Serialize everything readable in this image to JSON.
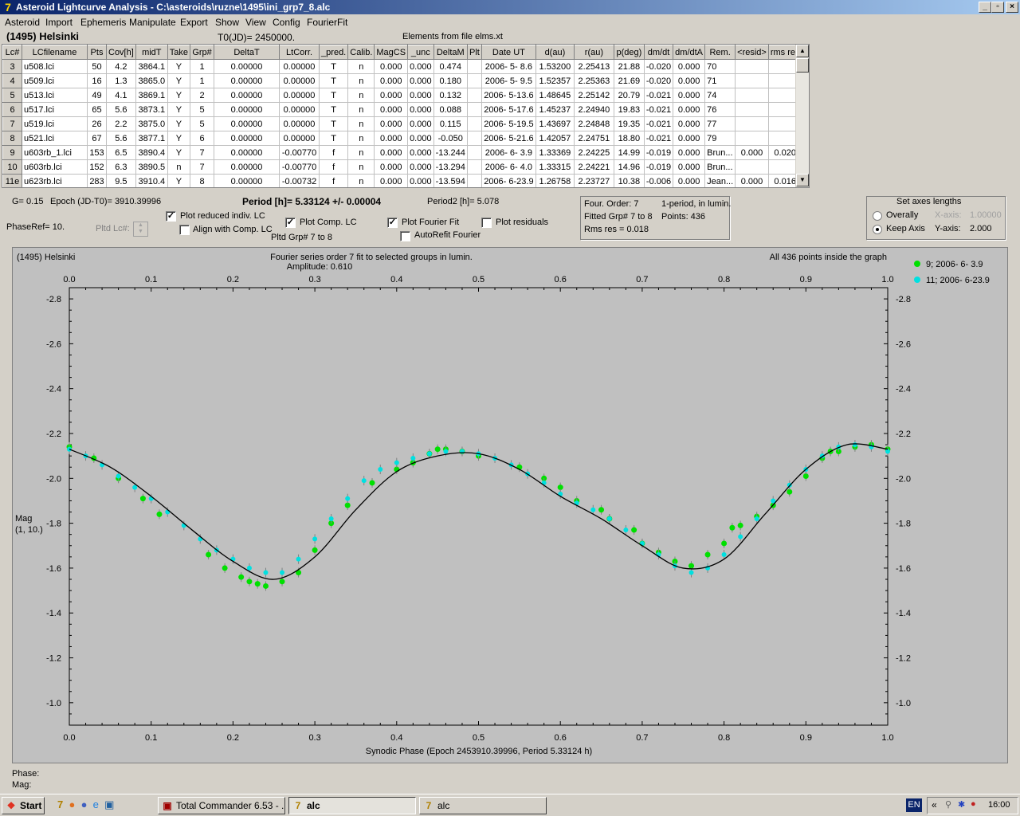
{
  "window": {
    "title": "Asteroid Lightcurve Analysis - C:\\asteroids\\ruzne\\1495\\ini_grp7_8.alc",
    "min_label": "_",
    "max_label": "▫",
    "close_label": "×"
  },
  "menu": [
    "Asteroid",
    "Import",
    "Ephemeris",
    "Manipulate",
    "Export",
    "Show",
    "View",
    "Config",
    "FourierFit"
  ],
  "header": {
    "asteroid": "(1495) Helsinki",
    "t0": "T0(JD)= 2450000.",
    "elements": "Elements from file elms.xt"
  },
  "table": {
    "columns": [
      "Lc#",
      "LCfilename",
      "Pts",
      "Cov[h]",
      "midT",
      "Take",
      "Grp#",
      "DeltaT",
      "LtCorr.",
      "_pred.",
      "Calib.",
      "MagCS",
      "_unc",
      "DeltaM",
      "Plt",
      "Date UT",
      "d(au)",
      "r(au)",
      "p(deg)",
      "dm/dt",
      "dm/dtA",
      "Rem.",
      "<resid>",
      "rms res"
    ],
    "rows": [
      [
        "3",
        "u508.lci",
        "50",
        "4.2",
        "3864.1",
        "Y",
        "1",
        "0.00000",
        "0.00000",
        "T",
        "n",
        "0.000",
        "0.000",
        "0.474",
        "",
        "2006- 5- 8.6",
        "1.53200",
        "2.25413",
        "21.88",
        "-0.020",
        "0.000",
        "70",
        "",
        ""
      ],
      [
        "4",
        "u509.lci",
        "16",
        "1.3",
        "3865.0",
        "Y",
        "1",
        "0.00000",
        "0.00000",
        "T",
        "n",
        "0.000",
        "0.000",
        "0.180",
        "",
        "2006- 5- 9.5",
        "1.52357",
        "2.25363",
        "21.69",
        "-0.020",
        "0.000",
        "71",
        "",
        ""
      ],
      [
        "5",
        "u513.lci",
        "49",
        "4.1",
        "3869.1",
        "Y",
        "2",
        "0.00000",
        "0.00000",
        "T",
        "n",
        "0.000",
        "0.000",
        "0.132",
        "",
        "2006- 5-13.6",
        "1.48645",
        "2.25142",
        "20.79",
        "-0.021",
        "0.000",
        "74",
        "",
        ""
      ],
      [
        "6",
        "u517.lci",
        "65",
        "5.6",
        "3873.1",
        "Y",
        "5",
        "0.00000",
        "0.00000",
        "T",
        "n",
        "0.000",
        "0.000",
        "0.088",
        "",
        "2006- 5-17.6",
        "1.45237",
        "2.24940",
        "19.83",
        "-0.021",
        "0.000",
        "76",
        "",
        ""
      ],
      [
        "7",
        "u519.lci",
        "26",
        "2.2",
        "3875.0",
        "Y",
        "5",
        "0.00000",
        "0.00000",
        "T",
        "n",
        "0.000",
        "0.000",
        "0.115",
        "",
        "2006- 5-19.5",
        "1.43697",
        "2.24848",
        "19.35",
        "-0.021",
        "0.000",
        "77",
        "",
        ""
      ],
      [
        "8",
        "u521.lci",
        "67",
        "5.6",
        "3877.1",
        "Y",
        "6",
        "0.00000",
        "0.00000",
        "T",
        "n",
        "0.000",
        "0.000",
        "-0.050",
        "",
        "2006- 5-21.6",
        "1.42057",
        "2.24751",
        "18.80",
        "-0.021",
        "0.000",
        "79",
        "",
        ""
      ],
      [
        "9",
        "u603rb_1.lci",
        "153",
        "6.5",
        "3890.4",
        "Y",
        "7",
        "0.00000",
        "-0.00770",
        "f",
        "n",
        "0.000",
        "0.000",
        "-13.244",
        "",
        "2006- 6- 3.9",
        "1.33369",
        "2.24225",
        "14.99",
        "-0.019",
        "0.000",
        "Brun...",
        "0.000",
        "0.020"
      ],
      [
        "10",
        "u603rb.lci",
        "152",
        "6.3",
        "3890.5",
        "n",
        "7",
        "0.00000",
        "-0.00770",
        "f",
        "n",
        "0.000",
        "0.000",
        "-13.294",
        "",
        "2006- 6- 4.0",
        "1.33315",
        "2.24221",
        "14.96",
        "-0.019",
        "0.000",
        "Brun...",
        "",
        ""
      ],
      [
        "11e",
        "u623rb.lci",
        "283",
        "9.5",
        "3910.4",
        "Y",
        "8",
        "0.00000",
        "-0.00732",
        "f",
        "n",
        "0.000",
        "0.000",
        "-13.594",
        "",
        "2006- 6-23.9",
        "1.26758",
        "2.23727",
        "10.38",
        "-0.006",
        "0.000",
        "Jean...",
        "0.000",
        "0.016"
      ]
    ]
  },
  "params": {
    "g": "G= 0.15",
    "epoch": "Epoch (JD-T0)= 3910.39996",
    "period": "Period [h]= 5.33124 +/- 0.00004",
    "period2": "Period2 [h]= 5.078",
    "phaseref": "PhaseRef= 10.",
    "pltd_lc": "Pltd Lc#:",
    "plot_reduced": "Plot reduced indiv. LC",
    "align_comp": "Align with Comp. LC",
    "plot_comp": "Plot Comp. LC",
    "pltd_grp": "Pltd Grp#  7  to  8",
    "plot_fourier": "Plot Fourier Fit",
    "autorefit": "AutoRefit Fourier",
    "plot_residuals": "Plot residuals"
  },
  "fourier_box": {
    "order": "Four. Order:  7",
    "mode": "1-period, in lumin.",
    "fitted": "Fitted Grp# 7 to 8",
    "points": "Points: 436",
    "rms": "Rms res     = 0.018"
  },
  "axes_box": {
    "title": "Set axes lengths",
    "overally": "Overally",
    "keep_axis": "Keep Axis",
    "xaxis_label": "X-axis:",
    "xaxis_value": "1.00000",
    "yaxis_label": "Y-axis:",
    "yaxis_value": "2.000"
  },
  "plot": {
    "name": "(1495) Helsinki",
    "subtitle": "Fourier series order 7 fit to selected groups in lumin.",
    "amplitude": "Amplitude: 0.610",
    "inside": "All 436 points inside the graph",
    "ylabel1": "Mag",
    "ylabel2": "(1, 10.)"
  },
  "chart_data": {
    "type": "scatter",
    "title": "Fourier series order 7 fit to selected groups in lumin.",
    "xlabel": "Synodic Phase (Epoch 2453910.39996, Period 5.33124 h)",
    "ylabel": "Mag",
    "xlim": [
      0.0,
      1.0
    ],
    "ylim": [
      -0.9,
      -2.85
    ],
    "y_inverted": true,
    "grid": false,
    "legend_position": "top-right",
    "x_ticks": [
      "0.0",
      "0.1",
      "0.2",
      "0.3",
      "0.4",
      "0.5",
      "0.6",
      "0.7",
      "0.8",
      "0.9",
      "1.0"
    ],
    "y_ticks": [
      "-2.8",
      "-2.6",
      "-2.4",
      "-2.2",
      "-2.0",
      "-1.8",
      "-1.6",
      "-1.4",
      "-1.2",
      "-1.0"
    ],
    "fit_curve": {
      "x": [
        0.0,
        0.05,
        0.1,
        0.15,
        0.2,
        0.25,
        0.3,
        0.35,
        0.4,
        0.45,
        0.5,
        0.55,
        0.6,
        0.65,
        0.7,
        0.75,
        0.8,
        0.85,
        0.9,
        0.95,
        1.0
      ],
      "y": [
        -2.13,
        -2.05,
        -1.92,
        -1.77,
        -1.63,
        -1.55,
        -1.65,
        -1.86,
        -2.03,
        -2.1,
        -2.11,
        -2.04,
        -1.92,
        -1.82,
        -1.7,
        -1.6,
        -1.64,
        -1.84,
        -2.04,
        -2.15,
        -2.13
      ]
    },
    "series": [
      {
        "name": "9; 2006- 6- 3.9",
        "color": "#00e000",
        "x": [
          0.0,
          0.03,
          0.06,
          0.09,
          0.11,
          0.17,
          0.19,
          0.21,
          0.22,
          0.23,
          0.24,
          0.26,
          0.28,
          0.3,
          0.32,
          0.34,
          0.37,
          0.4,
          0.42,
          0.44,
          0.45,
          0.46,
          0.48,
          0.5,
          0.55,
          0.58,
          0.6,
          0.62,
          0.65,
          0.66,
          0.69,
          0.7,
          0.72,
          0.74,
          0.76,
          0.78,
          0.8,
          0.81,
          0.82,
          0.84,
          0.86,
          0.88,
          0.9,
          0.92,
          0.93,
          0.94,
          0.96,
          0.98,
          1.0
        ],
        "y": [
          -2.14,
          -2.09,
          -2.0,
          -1.91,
          -1.84,
          -1.66,
          -1.6,
          -1.56,
          -1.54,
          -1.53,
          -1.52,
          -1.54,
          -1.58,
          -1.68,
          -1.8,
          -1.88,
          -1.98,
          -2.04,
          -2.07,
          -2.11,
          -2.13,
          -2.13,
          -2.12,
          -2.1,
          -2.05,
          -2.0,
          -1.96,
          -1.9,
          -1.86,
          -1.82,
          -1.77,
          -1.71,
          -1.67,
          -1.63,
          -1.61,
          -1.66,
          -1.71,
          -1.78,
          -1.79,
          -1.83,
          -1.88,
          -1.94,
          -2.01,
          -2.09,
          -2.12,
          -2.12,
          -2.14,
          -2.15,
          -2.13
        ]
      },
      {
        "name": "11; 2006- 6-23.9",
        "color": "#00e0e0",
        "x": [
          0.0,
          0.02,
          0.04,
          0.06,
          0.08,
          0.1,
          0.12,
          0.14,
          0.16,
          0.18,
          0.2,
          0.22,
          0.24,
          0.26,
          0.28,
          0.3,
          0.32,
          0.34,
          0.36,
          0.38,
          0.4,
          0.42,
          0.44,
          0.46,
          0.48,
          0.5,
          0.52,
          0.54,
          0.56,
          0.58,
          0.6,
          0.62,
          0.64,
          0.66,
          0.68,
          0.7,
          0.72,
          0.74,
          0.76,
          0.78,
          0.8,
          0.82,
          0.84,
          0.86,
          0.88,
          0.9,
          0.92,
          0.94,
          0.96,
          0.98,
          1.0
        ],
        "y": [
          -2.13,
          -2.1,
          -2.06,
          -2.01,
          -1.96,
          -1.91,
          -1.85,
          -1.79,
          -1.73,
          -1.68,
          -1.64,
          -1.6,
          -1.58,
          -1.58,
          -1.64,
          -1.73,
          -1.82,
          -1.91,
          -1.99,
          -2.04,
          -2.07,
          -2.09,
          -2.11,
          -2.12,
          -2.12,
          -2.11,
          -2.09,
          -2.06,
          -2.02,
          -1.98,
          -1.93,
          -1.89,
          -1.86,
          -1.82,
          -1.77,
          -1.71,
          -1.66,
          -1.61,
          -1.58,
          -1.6,
          -1.66,
          -1.74,
          -1.82,
          -1.9,
          -1.97,
          -2.04,
          -2.1,
          -2.14,
          -2.15,
          -2.14,
          -2.12
        ]
      }
    ]
  },
  "status": {
    "phase_label": "Phase:",
    "mag_label": "Mag:"
  },
  "taskbar": {
    "start": "Start",
    "tasks": [
      "Total Commander 6.53 - ...",
      "alc",
      "alc"
    ],
    "lang": "EN",
    "time": "16:00"
  }
}
